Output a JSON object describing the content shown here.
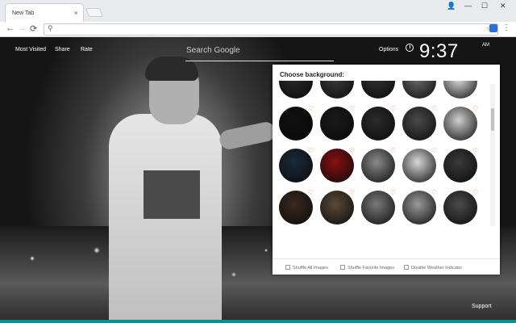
{
  "browser": {
    "tab_title": "New Tab",
    "tab_close": "×",
    "win_user": "👤",
    "win_min": "—",
    "win_max": "☐",
    "win_close": "✕",
    "nav_back": "←",
    "nav_forward": "→",
    "nav_reload": "⟳",
    "omnibox_search": "⚲",
    "omnibox_value": "",
    "omnibox_star": "☆",
    "menu": "⋮"
  },
  "page": {
    "links": [
      "Most Visited",
      "Share",
      "Rate"
    ],
    "search_placeholder": "Search Google",
    "options_label": "Options",
    "time": "9:37",
    "time_suffix": "AM",
    "support_label": "Support"
  },
  "panel": {
    "title": "Choose background:",
    "heart": "♡",
    "rows": [
      [
        {
          "color": "#2a2a2a"
        },
        {
          "color": "#3b3b3b"
        },
        {
          "color": "#303030"
        },
        {
          "color": "#6b6b6b"
        },
        {
          "color": "#e5e5e5"
        }
      ],
      [
        {
          "color": "#101010"
        },
        {
          "color": "#1a1a1a"
        },
        {
          "color": "#2b2b2b"
        },
        {
          "color": "#4a4a4a"
        },
        {
          "color": "#cfcfcf"
        }
      ],
      [
        {
          "color": "#1c2a3a"
        },
        {
          "color": "#8a1010"
        },
        {
          "color": "#8a8a8a"
        },
        {
          "color": "#d8d8d8"
        },
        {
          "color": "#3a3a3a"
        }
      ],
      [
        {
          "color": "#3a2a20"
        },
        {
          "color": "#5a4a3a"
        },
        {
          "color": "#7a7a7a"
        },
        {
          "color": "#9a9a9a"
        },
        {
          "color": "#4a4a4a"
        }
      ]
    ],
    "checkboxes": [
      "Shuffle All Images",
      "Shuffle Favorite Images",
      "Disable Weather Indicator"
    ]
  },
  "colors": {
    "accent_heart": "#e8703a",
    "bottom_bar": "#0b8d8e"
  }
}
